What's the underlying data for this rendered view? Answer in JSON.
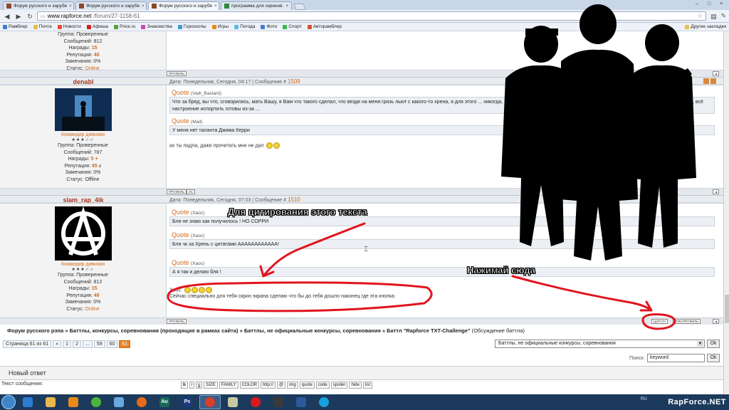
{
  "browser": {
    "tabs": [
      {
        "title": "Форум русского и зарубе",
        "close": "×"
      },
      {
        "title": "Форум русского и зарубе",
        "close": "×"
      },
      {
        "title": "Форум русского и зарубе",
        "close": "×"
      },
      {
        "title": "программа для скринов",
        "close": "×"
      }
    ],
    "url_host": "www.rapforce.net",
    "url_path": "/forum/27-1158-61",
    "bookmarks": [
      "Рамблер",
      "Почта",
      "Новости",
      "Афиша",
      "Price.ru",
      "Знакомства",
      "Гороскопы",
      "Игры",
      "Погода",
      "Фото",
      "Спорт",
      "Авторамблер"
    ],
    "other_bookmarks": "Другие закладки",
    "window_controls": [
      "–",
      "□",
      "×"
    ]
  },
  "post_prev": {
    "group": "Группа: Проверенные",
    "messages": "Сообщений: 812",
    "awards_label": "Награды:",
    "awards": "15",
    "rep_label": "Репутация:",
    "rep": "48",
    "warn": "Замечания: 0%",
    "status_label": "Статус:",
    "status": "Online",
    "profile_btn": "ПРОФИЛЬ"
  },
  "post1": {
    "username": "denabl",
    "meta": "Дата: Понедельник, Сегодня, 04:17 | Сообщение #",
    "num": "1509",
    "rank": "Командир дивизии",
    "stars": "★★★☆☆",
    "group": "Группа: Проверенные",
    "messages": "Сообщений: 787",
    "awards_label": "Награды:",
    "awards": "5",
    "awards_plus": "+",
    "rep_label": "Репутация:",
    "rep": "45",
    "rep_pm": "±",
    "warn": "Замечания: 0%",
    "status_label": "Статус:",
    "status": "Offline",
    "q1_label": "Quote",
    "q1_author": "(Vadi_Bastard)",
    "q1_text": "Что за бред, вы что, сговорились, мать Вашу, я Вам что такого сделал, что везде на меня грязь льют с какого-то хрена, я для этого ... никогда, за*бали, убейтесь об стену все идиоты грёбаные, кто воспримет это на свой счёт, всё настроение испортить готовы из-за ...",
    "q2_label": "Quote",
    "q2_author": "(Mail)",
    "q2_text": "У меня нет таланта Джима Керри",
    "text": "ах ты падла, даже прочитать мне не дал",
    "btn_profile": "ПРОФИЛЬ",
    "btn_pm": "ЛС"
  },
  "post2": {
    "username": "slam_rap_4ik",
    "meta": "Дата: Понедельник, Сегодня, 07:03 | Сообщение #",
    "num": "1510",
    "rank": "Командир дивизии",
    "stars": "★★★☆☆",
    "group": "Группа: Проверенные",
    "messages": "Сообщений: 812",
    "awards_label": "Награды:",
    "awards": "15",
    "rep_label": "Репутация:",
    "rep": "48",
    "warn": "Замечания: 0%",
    "status_label": "Статус:",
    "status": "Online",
    "q1_label": "Quote",
    "q1_author": "(Хаос)",
    "q1_text": "Бля не знаю как получилось ! НО СОРРИ",
    "q2_label": "Quote",
    "q2_author": "(Хаос)",
    "q2_text": "Бля чк за Хрень с цитатами АААААААААААА!",
    "q3_label": "Quote",
    "q3_author": "(Хаос)",
    "q3_text": "А я так и делаю бля !",
    "text_label": "Хаос:",
    "text": "Сейчас специально для тебя скрин экрана сделаю что бы до тебя дошло наконец где эта кнопка",
    "btn_profile": "ПРОФИЛЬ",
    "btn_quote": "ЦИТАТА",
    "btn_edit": "ИЗМ.ПРОФИЛЬ"
  },
  "breadcrumb": {
    "path": "Форум русского рэпа » Баттлы, конкурсы, соревнования (проходящие в рамках сайта) » Баттлы, не официальные конкурсы, соревнования » Баттл \"Rapforce TXT-Challenge\"",
    "suffix": "(Обсуждение баттла)"
  },
  "pagination": {
    "label": "Страница 61 из 61",
    "items": [
      "«",
      "1",
      "2",
      "...",
      "59",
      "60",
      "61"
    ]
  },
  "jump": {
    "selected": "Баттлы, не официальные конкурсы, соревнования",
    "ok": "Ok"
  },
  "search": {
    "label": "Поиск:",
    "value": "keyword",
    "ok": "Ok"
  },
  "reply": {
    "title": "Новый ответ",
    "message_label": "Текст сообщения:",
    "toolbar": [
      "b",
      "i",
      "u",
      "SIZE",
      "FAMILY",
      "COLOR",
      "http://",
      "@",
      "img",
      "quote",
      "code",
      "spoiler",
      "hide",
      "list"
    ]
  },
  "annotations": {
    "quote_hint": "Для цитирования этого текста",
    "click_hint": "Нажимай сюда"
  },
  "taskbar": {
    "lang": "RU",
    "watermark": "RapForce.NET"
  },
  "colors": {
    "accent": "#d46a1a",
    "username": "#a8331d",
    "annotation": "#e0141e"
  }
}
